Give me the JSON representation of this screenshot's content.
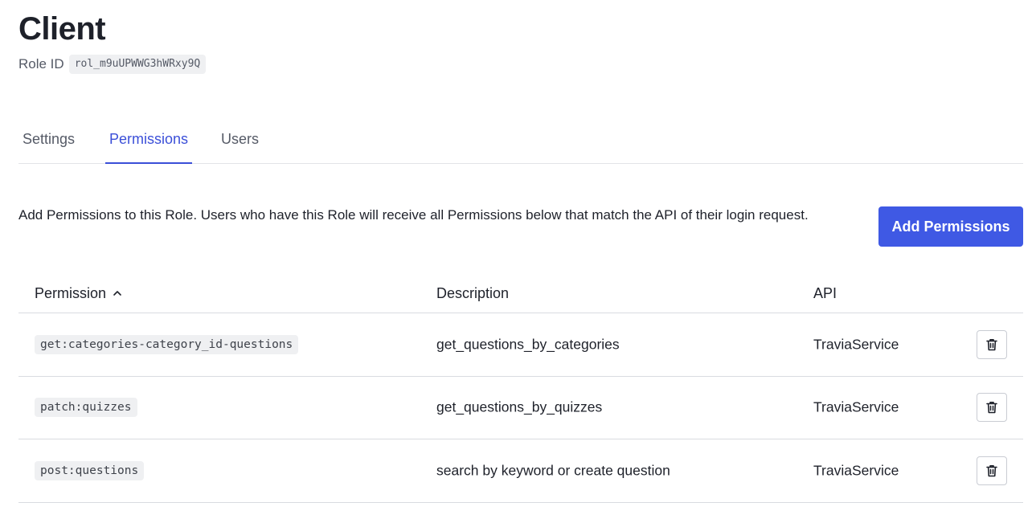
{
  "header": {
    "title": "Client",
    "role_id_label": "Role ID",
    "role_id_value": "rol_m9uUPWWG3hWRxy9Q"
  },
  "tabs": [
    {
      "label": "Settings",
      "active": false
    },
    {
      "label": "Permissions",
      "active": true
    },
    {
      "label": "Users",
      "active": false
    }
  ],
  "permissions_section": {
    "intro": "Add Permissions to this Role. Users who have this Role will receive all Permissions below that match the API of their login request.",
    "add_button_label": "Add Permissions"
  },
  "table": {
    "columns": {
      "permission": "Permission",
      "description": "Description",
      "api": "API"
    },
    "sort": {
      "column": "permission",
      "direction": "ascending",
      "icon": "chevron-up-icon"
    },
    "rows": [
      {
        "permission": "get:categories-category_id-questions",
        "description": "get_questions_by_categories",
        "api": "TraviaService"
      },
      {
        "permission": "patch:quizzes",
        "description": "get_questions_by_quizzes",
        "api": "TraviaService"
      },
      {
        "permission": "post:questions",
        "description": "search by keyword or create question",
        "api": "TraviaService"
      }
    ],
    "row_action_icon": "trash-icon"
  },
  "colors": {
    "accent": "#3f59e4",
    "tab_active": "#3b4fd8",
    "text": "#1e212a",
    "code_bg": "#eff0f2"
  }
}
